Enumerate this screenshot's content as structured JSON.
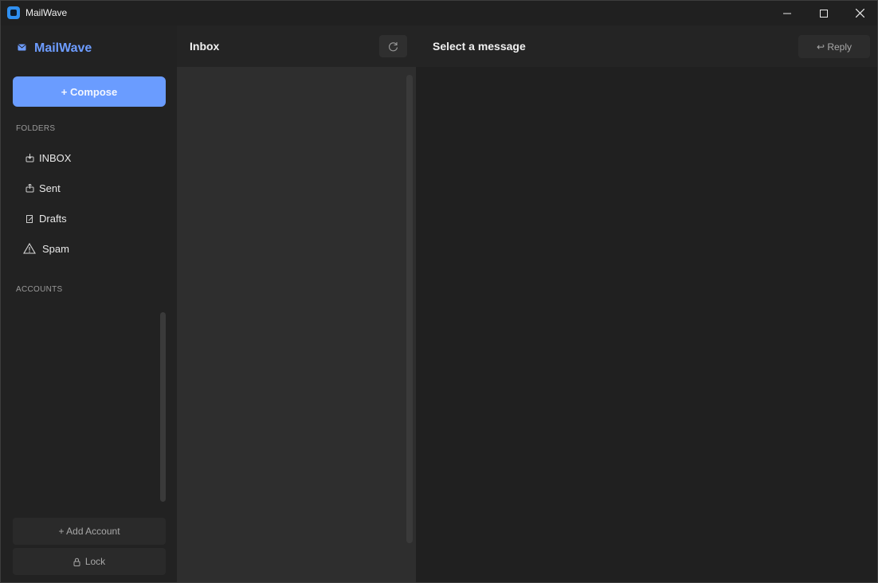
{
  "window": {
    "title": "MailWave"
  },
  "sidebar": {
    "brand": "MailWave",
    "compose_label": "+ Compose",
    "folders_label": "FOLDERS",
    "folders": [
      {
        "label": "INBOX",
        "icon": "inbox-tray-icon"
      },
      {
        "label": "Sent",
        "icon": "outbox-tray-icon"
      },
      {
        "label": "Drafts",
        "icon": "document-edit-icon"
      },
      {
        "label": "Spam",
        "icon": "warning-icon"
      }
    ],
    "accounts_label": "ACCOUNTS",
    "add_account_label": "+ Add Account",
    "lock_label": "Lock"
  },
  "list": {
    "title": "Inbox"
  },
  "reader": {
    "title": "Select a message",
    "reply_label": "↩ Reply"
  },
  "colors": {
    "accent": "#6a9cff",
    "brand": "#6d9cff",
    "background": "#202020",
    "list_background": "#2e2e2e"
  }
}
